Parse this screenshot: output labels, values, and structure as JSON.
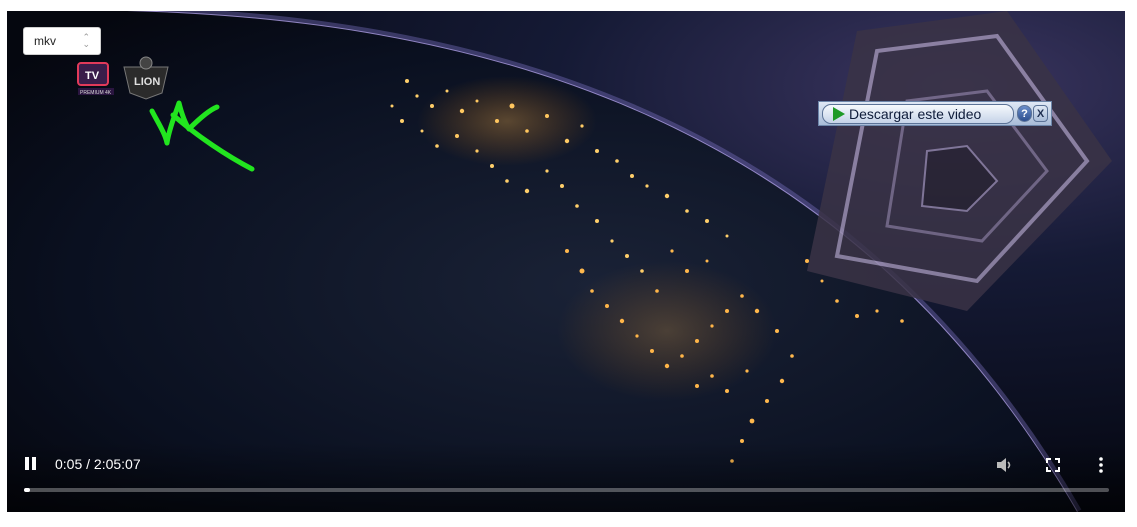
{
  "format_select": {
    "value": "mkv"
  },
  "download_bar": {
    "label": "Descargar este video",
    "help": "?",
    "close": "X"
  },
  "logos": {
    "tv_text": "TV",
    "tv_sub": "PREMIUM 4K",
    "lion_text": "LION"
  },
  "player": {
    "time": "0:05 / 2:05:07",
    "progress": 0.005,
    "state": "playing"
  },
  "colors": {
    "annotation": "#22e51f",
    "accent": "#1f9a27"
  }
}
